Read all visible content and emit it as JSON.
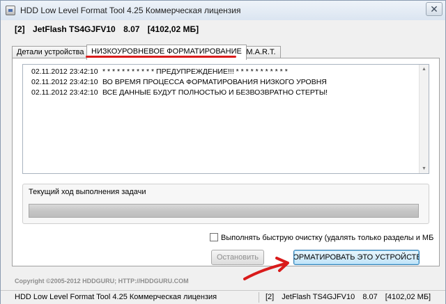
{
  "window": {
    "title": "HDD Low Level Format Tool 4.25    Коммерческая лицензия",
    "close_glyph": "✕"
  },
  "device": {
    "index": "[2]",
    "name": "JetFlash TS4GJFV10",
    "firmware": "8.07",
    "size": "[4102,02 МБ]"
  },
  "tabs": [
    {
      "label": "Детали устройства"
    },
    {
      "label": "НИЗКОУРОВНЕВОЕ ФОРМАТИРОВАНИЕ"
    },
    {
      "label": "S.M.A.R.T."
    }
  ],
  "log": [
    {
      "time": "02.11.2012 23:42:10",
      "text": "* * * * * * * * * * * ПРЕДУПРЕЖДЕНИЕ!!! * * * * * * * * * * *"
    },
    {
      "time": "02.11.2012 23:42:10",
      "text": "ВО ВРЕМЯ ПРОЦЕССА ФОРМАТИРОВАНИЯ НИЗКОГО УРОВНЯ"
    },
    {
      "time": "02.11.2012 23:42:10",
      "text": "ВСЕ ДАННЫЕ БУДУТ ПОЛНОСТЬЮ И БЕЗВОЗВРАТНО СТЕРТЫ!"
    }
  ],
  "progress": {
    "label": "Текущий ход выполнения задачи",
    "fraction": 0
  },
  "quick_clean": {
    "label": "Выполнять быструю очистку (удалять только разделы и МБ",
    "checked": false
  },
  "buttons": {
    "stop": "Остановить",
    "format": "ФОРМАТИРОВАТЬ ЭТО УСТРОЙСТВО"
  },
  "copyright": "Copyright ©2005-2012 HDDGURU;   HTTP://HDDGURU.COM",
  "status": {
    "left": "HDD Low Level Format Tool 4.25    Коммерческая лицензия",
    "index": "[2]",
    "name": "JetFlash TS4GJFV10",
    "firmware": "8.07",
    "size": "[4102,02 МБ]"
  },
  "colors": {
    "annotation_red": "#d91b1b",
    "format_button_border": "#3c7fb1"
  },
  "icons": {
    "app": "hdd-tool-icon",
    "close": "close-icon",
    "annotation": "red-arrow-annotation"
  }
}
